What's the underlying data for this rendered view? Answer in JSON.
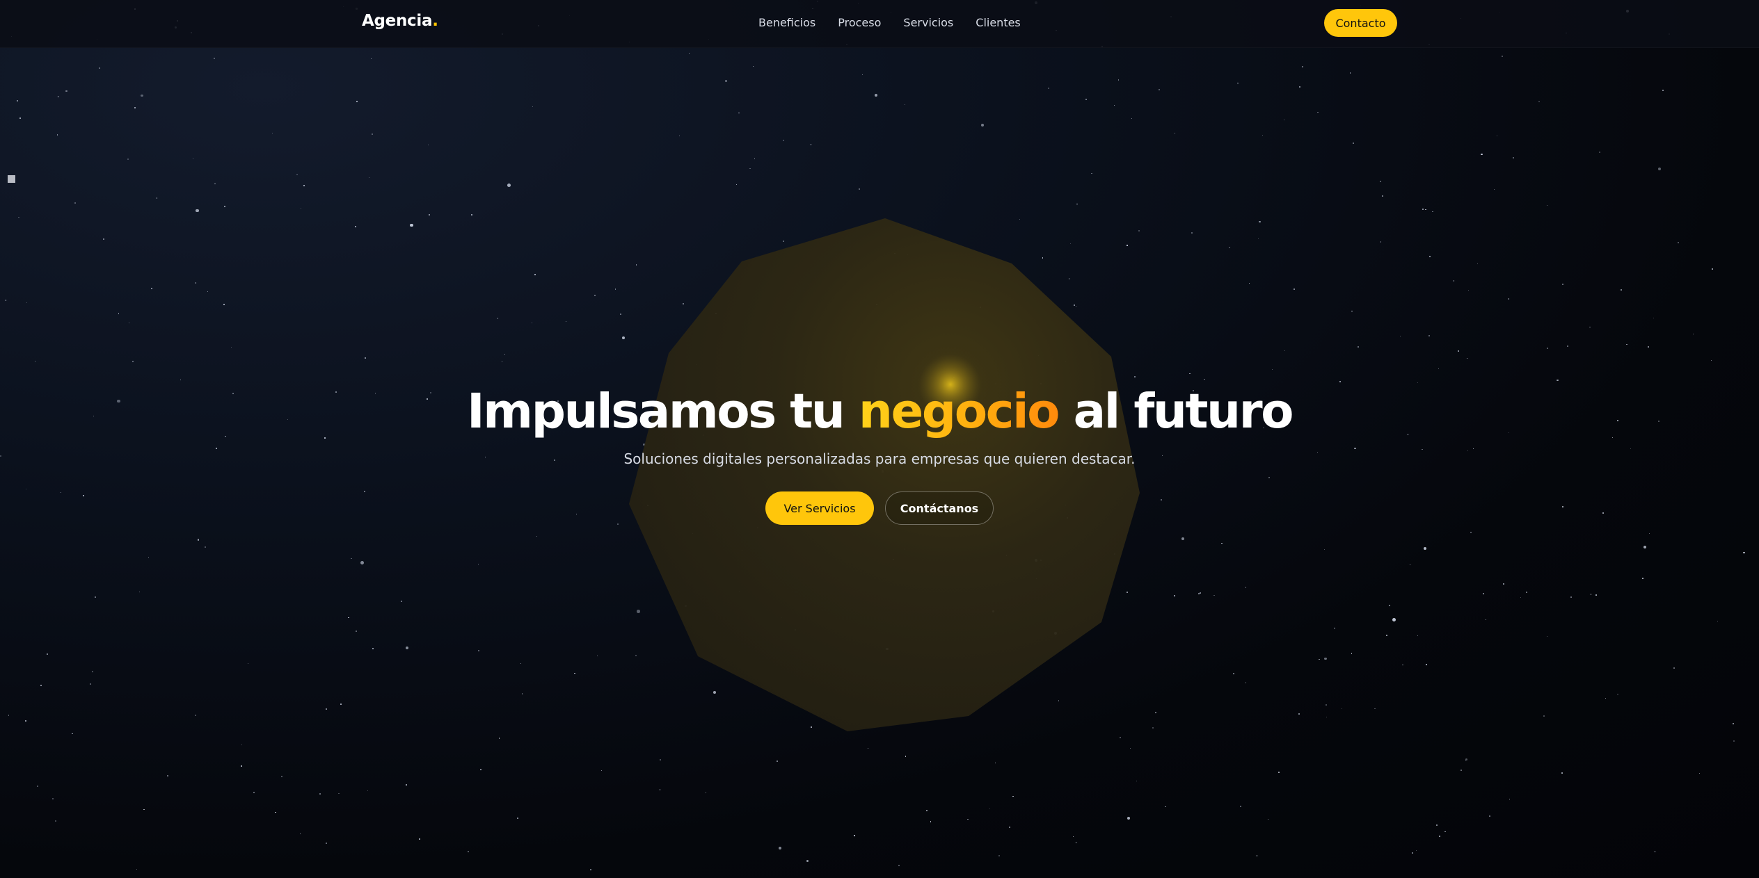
{
  "header": {
    "logo_text": "Agencia",
    "logo_dot": ".",
    "nav_links": [
      "Beneficios",
      "Proceso",
      "Servicios",
      "Clientes"
    ],
    "cta_label": "Contacto"
  },
  "hero": {
    "title_before": "Impulsamos tu ",
    "title_highlight": "negocio",
    "title_after": " al futuro",
    "subtitle": "Soluciones digitales personalizadas para empresas que quieren destacar.",
    "primary_button": "Ver Servicios",
    "secondary_button": "Contáctanos"
  },
  "colors": {
    "accent": "#ffc60b",
    "accent_gradient_end": "#ff8a0c",
    "background": "#05070d",
    "text": "#ffffff"
  }
}
